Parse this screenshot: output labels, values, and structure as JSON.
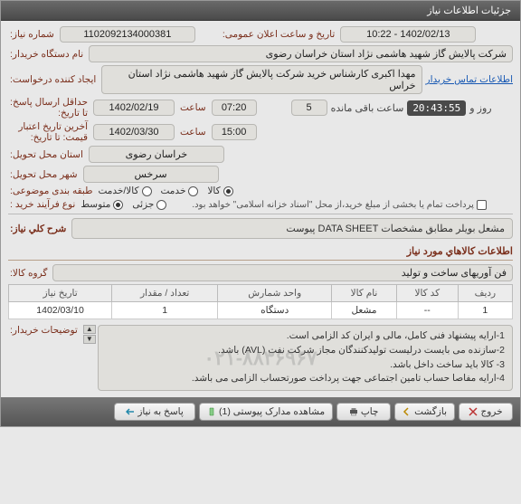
{
  "window": {
    "title": "جزئیات اطلاعات نیاز"
  },
  "labels": {
    "need_no": "شماره نیاز:",
    "announce_datetime": "تاریخ و ساعت اعلان عمومی:",
    "buyer_org": "نام دستگاه خریدار:",
    "requester": "ایجاد کننده درخواست:",
    "contact_info": "اطلاعات تماس خریدار",
    "deadline": "حداقل ارسال پاسخ: تا تاریخ:",
    "hour": "ساعت",
    "day_and": "روز و",
    "remaining": "ساعت باقی مانده",
    "validity": "آخرین تاریخ اعتبار قیمت: تا تاریخ:",
    "province": "استان محل تحویل:",
    "city": "شهر محل تحویل:",
    "categorization": "طبقه بندی موضوعی:",
    "purchase_type": "نوع فرآیند خرید :",
    "payment_note": "پرداخت تمام یا بخشی از مبلغ خرید،از محل \"اسناد خزانه اسلامی\" خواهد بود.",
    "need_title": "شرح کلي نياز:",
    "section_items": "اطلاعات كالاهاي مورد نياز",
    "goods_group": "گروه کالا:",
    "buyer_notes": "توضیحات خریدار:"
  },
  "fields": {
    "need_no": "1102092134000381",
    "announce_datetime": "1402/02/13 - 10:22",
    "buyer_org": "شرکت پالایش گاز شهید هاشمی نژاد   استان خراسان رضوی",
    "requester": "مهدا اکبری کارشناس خرید شرکت پالایش گاز شهید هاشمی نژاد   استان خراس",
    "deadline_date": "1402/02/19",
    "deadline_time": "07:20",
    "days_left": "5",
    "countdown_clock": "20:43:55",
    "validity_date": "1402/03/30",
    "validity_time": "15:00",
    "province": "خراسان رضوی",
    "city": "سرخس",
    "need_title": "مشعل بویلر مطابق مشخصات DATA SHEET پیوست",
    "goods_group": "فن آوریهای ساخت و تولید"
  },
  "category_opts": {
    "goods": "کالا",
    "service": "خدمت",
    "both": "کالا/خدمت"
  },
  "purchase_opts": {
    "partial": "جزئی",
    "medium": "متوسط"
  },
  "table": {
    "headers": {
      "row": "ردیف",
      "code": "کد کالا",
      "name": "نام کالا",
      "unit": "واحد شمارش",
      "qty": "تعداد / مقدار",
      "need_date": "تاریخ نیاز"
    },
    "rows": [
      {
        "row": "1",
        "code": "--",
        "name": "مشعل",
        "unit": "دستگاه",
        "qty": "1",
        "need_date": "1402/03/10"
      }
    ]
  },
  "buyer_notes_lines": [
    "1-ارایه پیشنهاد فنی کامل، مالی و ایران کد  الزامی است.",
    "2-سازنده می بایست درلیست تولیدکنندگان مجاز شرکت نفت  (AVL)  باشد.",
    "3- کالا باید ساخت داخل باشد.",
    "4-ارایه مفاصا حساب تامین اجتماعی جهت پرداخت صورتحساب الزامی می باشد."
  ],
  "contact_phone_partial": "۰۲۱-۸۸۳۶۹۶۷",
  "buttons": {
    "respond": "پاسخ به نیاز",
    "attachments": "مشاهده مدارک پیوستی (1)",
    "print": "چاپ",
    "back": "بازگشت",
    "exit": "خروج"
  }
}
